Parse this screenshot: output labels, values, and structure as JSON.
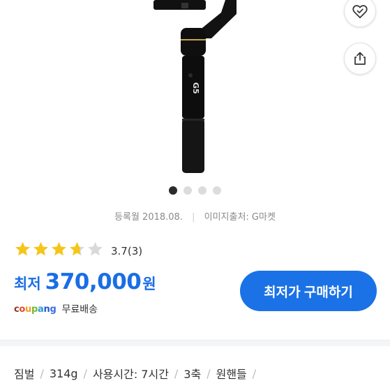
{
  "product": {
    "image_dots": [
      true,
      false,
      false,
      false
    ],
    "registered": "등록월 2018.08.",
    "image_source": "이미지출처: G마켓",
    "rating": {
      "stars": 3.7,
      "score": "3.7",
      "count": "(3)",
      "star_color": "#f5c518",
      "star_empty_color": "#d9d9d9"
    },
    "price": {
      "label": "최저",
      "value": "370,000",
      "unit": "원",
      "color": "#1a6de5"
    },
    "seller": {
      "logo_letters": [
        "c",
        "o",
        "u",
        "p",
        "a",
        "n",
        "g"
      ],
      "logo_colors": [
        "#8b3a1f",
        "#e24a2a",
        "#f0a31d",
        "#79b43a",
        "#2d9bd3",
        "#1e5bd1",
        "#3c6ee0"
      ],
      "shipping": "무료배송"
    },
    "buy_button_label": "최저가 구매하기",
    "specs": [
      "짐벌",
      "314g",
      "사용시간: 7시간",
      "3축",
      "원핸들"
    ]
  },
  "icons": {
    "wish": "heart-check-icon",
    "share": "share-icon"
  }
}
